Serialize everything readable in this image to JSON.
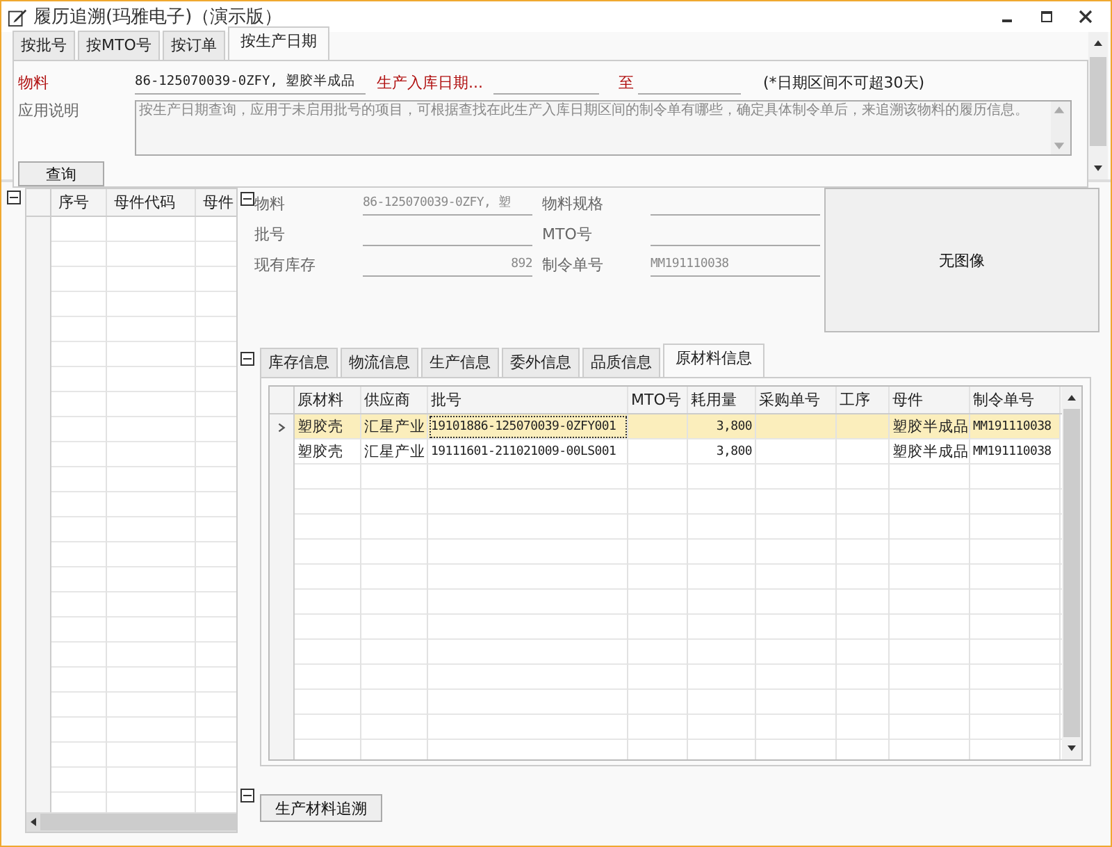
{
  "window": {
    "title": "履历追溯(玛雅电子)（演示版）"
  },
  "query_tabs": [
    {
      "label": "按批号",
      "selected": false
    },
    {
      "label": "按MTO号",
      "selected": false
    },
    {
      "label": "按订单",
      "selected": false
    },
    {
      "label": "按生产日期",
      "selected": true
    }
  ],
  "query_form": {
    "material_label": "物料",
    "material_value": "86-125070039-0ZFY, 塑胶半成品",
    "date_label": "生产入库日期...",
    "to_label": "至",
    "date_note": "(*日期区间不可超30天)",
    "description_label": "应用说明",
    "description": "按生产日期查询，应用于未启用批号的项目，可根据查找在此生产入库日期区间的制令单有哪些，确定具体制令单后，来追溯该物料的履历信息。",
    "query_button": "查询"
  },
  "parent_grid": {
    "columns": [
      "序号",
      "母件代码",
      "母件"
    ]
  },
  "detail": {
    "fields": [
      {
        "label": "物料",
        "value": "86-125070039-0ZFY, 塑"
      },
      {
        "label": "物料规格"
      },
      {
        "label": "批号"
      },
      {
        "label": "MTO号"
      },
      {
        "label": "现有库存",
        "value": "892",
        "numeric": true
      },
      {
        "label": "制令单号",
        "value": "MM191110038"
      }
    ],
    "image_placeholder": "无图像"
  },
  "detail_tabs": [
    {
      "label": "库存信息",
      "selected": false
    },
    {
      "label": "物流信息",
      "selected": false
    },
    {
      "label": "生产信息",
      "selected": false
    },
    {
      "label": "委外信息",
      "selected": false
    },
    {
      "label": "品质信息",
      "selected": false
    },
    {
      "label": "原材料信息",
      "selected": true
    }
  ],
  "materials_grid": {
    "columns": [
      "原材料",
      "供应商",
      "批号",
      "MTO号",
      "耗用量",
      "采购单号",
      "工序",
      "母件",
      "制令单号"
    ],
    "rows": [
      {
        "selected": true,
        "cells": [
          "塑胶壳",
          "汇星产业",
          "19101886-125070039-0ZFY001",
          "",
          "3,800",
          "",
          "",
          "塑胶半成品",
          "MM191110038"
        ]
      },
      {
        "selected": false,
        "cells": [
          "塑胶壳",
          "汇星产业",
          "19111601-211021009-00LS001",
          "",
          "3,800",
          "",
          "",
          "塑胶半成品",
          "MM191110038"
        ]
      }
    ]
  },
  "trace_button": "生产材料追溯"
}
